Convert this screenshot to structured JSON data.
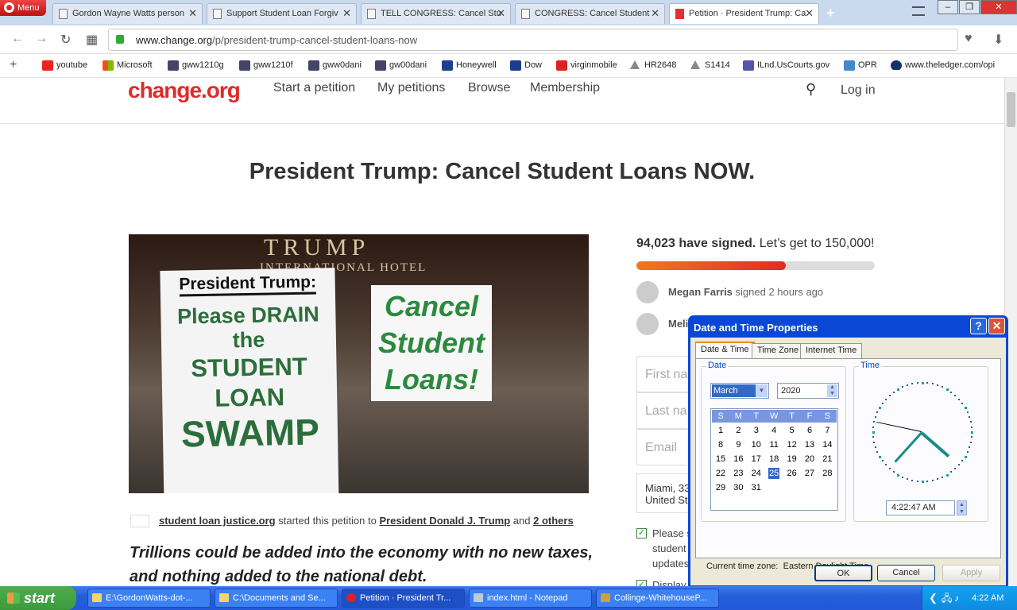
{
  "browser": {
    "menu_label": "Menu",
    "tabs": [
      {
        "title": "Gordon Wayne Watts person"
      },
      {
        "title": "Support Student Loan Forgiv"
      },
      {
        "title": "TELL CONGRESS: Cancel Stu"
      },
      {
        "title": "CONGRESS: Cancel Student"
      },
      {
        "title": "Petition · President Trump: Ca"
      }
    ],
    "url_host": "www.change.org",
    "url_path": "/p/president-trump-cancel-student-loans-now",
    "bookmarks": [
      {
        "label": "youtube",
        "color": "#e22"
      },
      {
        "label": "Microsoft",
        "color": "#3b7"
      },
      {
        "label": "gww1210g",
        "color": "#446"
      },
      {
        "label": "gww1210f",
        "color": "#446"
      },
      {
        "label": "gww0dani",
        "color": "#446"
      },
      {
        "label": "gw00dani",
        "color": "#446"
      },
      {
        "label": "Honeywell",
        "color": "#1a3f8f"
      },
      {
        "label": "Dow",
        "color": "#1a3f8f"
      },
      {
        "label": "virginmobile",
        "color": "#d22"
      },
      {
        "label": "HR2648",
        "color": "#888"
      },
      {
        "label": "S1414",
        "color": "#888"
      },
      {
        "label": "ILnd.UsCourts.gov",
        "color": "#55a"
      },
      {
        "label": "OPR",
        "color": "#48c"
      },
      {
        "label": "www.theledger.com/opi",
        "color": "#136"
      }
    ]
  },
  "site": {
    "logo": "change.org",
    "nav": [
      "Start a petition",
      "My petitions",
      "Browse",
      "Membership"
    ],
    "login": "Log in"
  },
  "petition": {
    "title": "President Trump: Cancel Student Loans NOW.",
    "photo": {
      "hotel_line1": "TRUMP",
      "hotel_line2": "INTERNATIONAL HOTEL",
      "sign1_l1": "President Trump:",
      "sign1_l2": "Please DRAIN",
      "sign1_l2b": "the",
      "sign1_l3": "STUDENT LOAN",
      "sign1_l4": "SWAMP",
      "sign2": "Cancel Student Loans!"
    },
    "starter_name": "student loan justice.org",
    "starter_mid": "started this petition to",
    "target": "President Donald J. Trump",
    "and": "and",
    "others": "2 others",
    "lede": "Trillions could be added  into the economy with no new taxes, and nothing added to the national debt.",
    "signed_count": "94,023 have signed.",
    "goal": "Let’s get to 150,000!",
    "progress": 0.627,
    "signers": [
      {
        "name": "Megan Farris",
        "action": "signed 2 hours ago"
      },
      {
        "name": "Melis",
        "action": ""
      }
    ],
    "form": {
      "first_name": "First na",
      "last_name": "Last na",
      "email": "Email",
      "location1": "Miami, 33",
      "location2": "United St"
    },
    "check1": "Please s",
    "check1b": "student",
    "check1c": "updates",
    "check2": "Display"
  },
  "dialog": {
    "title": "Date and Time Properties",
    "tabs": [
      "Date & Time",
      "Time Zone",
      "Internet Time"
    ],
    "date_label": "Date",
    "time_label": "Time",
    "month": "March",
    "year": "2020",
    "weekdays": [
      "S",
      "M",
      "T",
      "W",
      "T",
      "F",
      "S"
    ],
    "days": [
      [
        "1",
        "2",
        "3",
        "4",
        "5",
        "6",
        "7"
      ],
      [
        "8",
        "9",
        "10",
        "11",
        "12",
        "13",
        "14"
      ],
      [
        "15",
        "16",
        "17",
        "18",
        "19",
        "20",
        "21"
      ],
      [
        "22",
        "23",
        "24",
        "25",
        "26",
        "27",
        "28"
      ],
      [
        "29",
        "30",
        "31",
        "",
        "",
        "",
        ""
      ]
    ],
    "selected_day": "25",
    "time": "4:22:47 AM",
    "tz_label": "Current time zone:",
    "tz_value": "Eastern Daylight Time",
    "ok": "OK",
    "cancel": "Cancel",
    "apply": "Apply"
  },
  "taskbar": {
    "start": "start",
    "tasks": [
      "E:\\GordonWatts-dot-...",
      "C:\\Documents and Se...",
      "Petition · President Tr...",
      "index.html - Notepad",
      "Collinge-WhitehouseP..."
    ],
    "clock": "4:22 AM"
  }
}
